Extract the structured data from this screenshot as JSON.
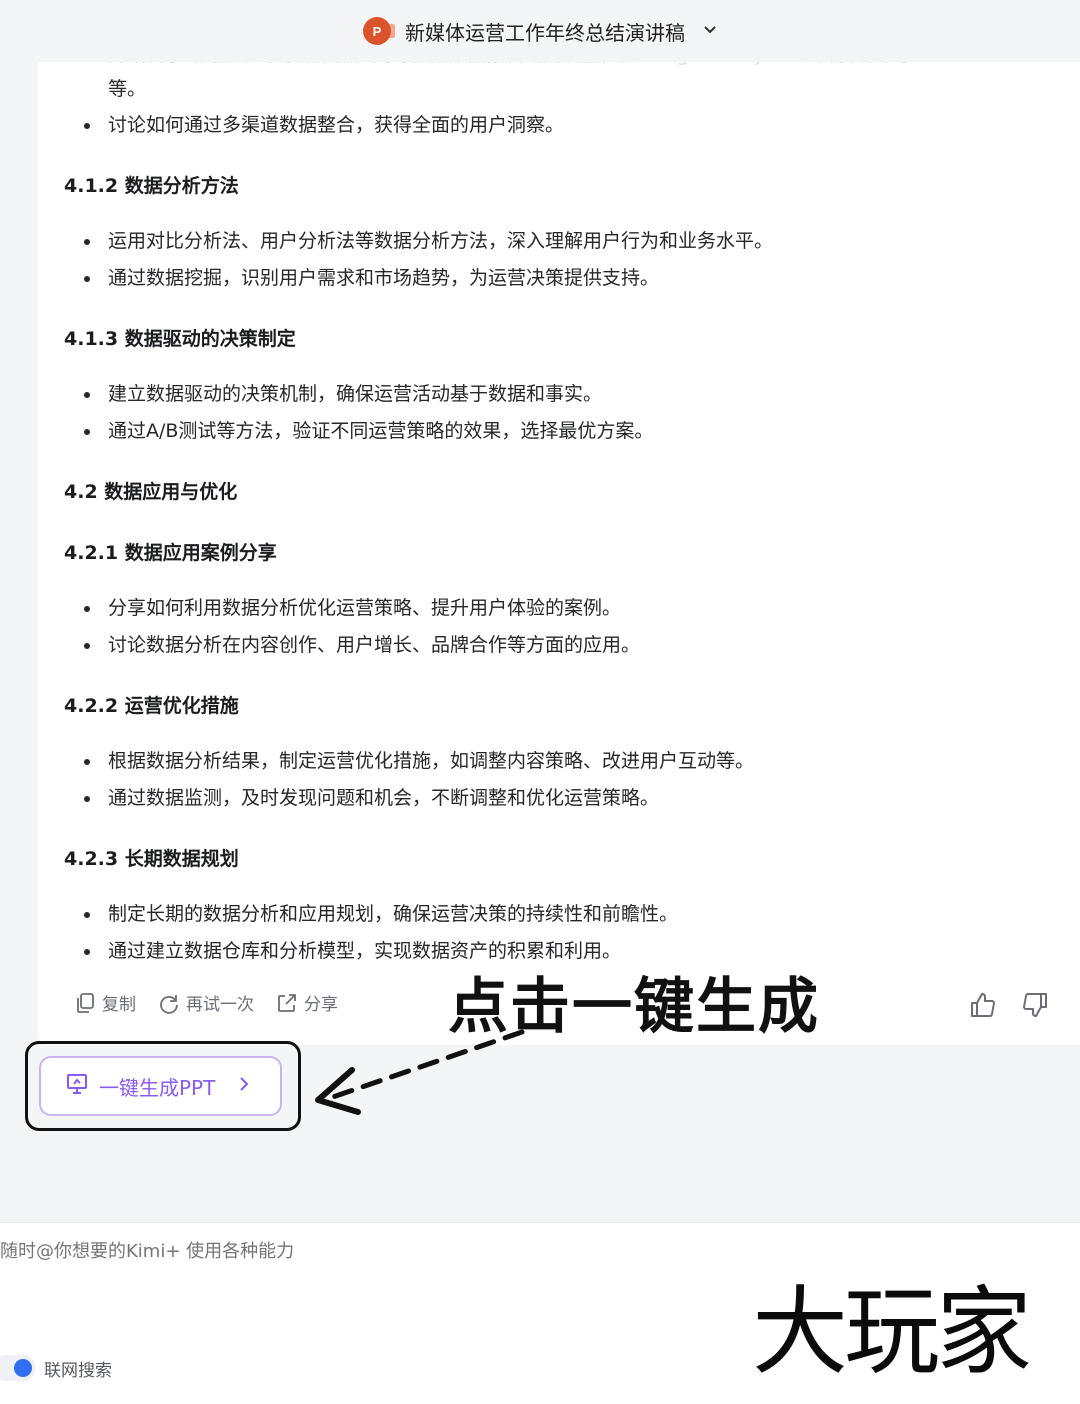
{
  "header": {
    "doc_title": "新媒体运营工作年终总结演讲稿",
    "app_icon": "P"
  },
  "content": {
    "faded_line": "并结合了\"数据湖\"等存储数据，同时根据数据报告定期调整，如Google Analytics、百度统计等",
    "continuation": "等。",
    "top_bullets": [
      "讨论如何通过多渠道数据整合，获得全面的用户洞察。"
    ],
    "sections": [
      {
        "heading": "4.1.2 数据分析方法",
        "bullets": [
          "运用对比分析法、用户分析法等数据分析方法，深入理解用户行为和业务水平。",
          "通过数据挖掘，识别用户需求和市场趋势，为运营决策提供支持。"
        ]
      },
      {
        "heading": "4.1.3 数据驱动的决策制定",
        "bullets": [
          "建立数据驱动的决策机制，确保运营活动基于数据和事实。",
          "通过A/B测试等方法，验证不同运营策略的效果，选择最优方案。"
        ]
      },
      {
        "heading": "4.2 数据应用与优化",
        "bullets": []
      },
      {
        "heading": "4.2.1 数据应用案例分享",
        "bullets": [
          "分享如何利用数据分析优化运营策略、提升用户体验的案例。",
          "讨论数据分析在内容创作、用户增长、品牌合作等方面的应用。"
        ]
      },
      {
        "heading": "4.2.2 运营优化措施",
        "bullets": [
          "根据数据分析结果，制定运营优化措施，如调整内容策略、改进用户互动等。",
          "通过数据监测，及时发现问题和机会，不断调整和优化运营策略。"
        ]
      },
      {
        "heading": "4.2.3 长期数据规划",
        "bullets": [
          "制定长期的数据分析和应用规划，确保运营决策的持续性和前瞻性。",
          "通过建立数据仓库和分析模型，实现数据资产的积累和利用。"
        ]
      }
    ]
  },
  "actions": {
    "copy": "复制",
    "retry": "再试一次",
    "share": "分享"
  },
  "annotation": {
    "callout": "点击一键生成"
  },
  "ppt_button": {
    "label": "一键生成PPT"
  },
  "input": {
    "placeholder": "随时@你想要的Kimi+ 使用各种能力",
    "web_search_label": "联网搜索"
  },
  "watermark": {
    "text": "大玩家"
  },
  "colors": {
    "accent_purple": "#8a5bf0",
    "toggle_blue": "#2f6ff0",
    "ppt_orange": "#d9542a"
  }
}
